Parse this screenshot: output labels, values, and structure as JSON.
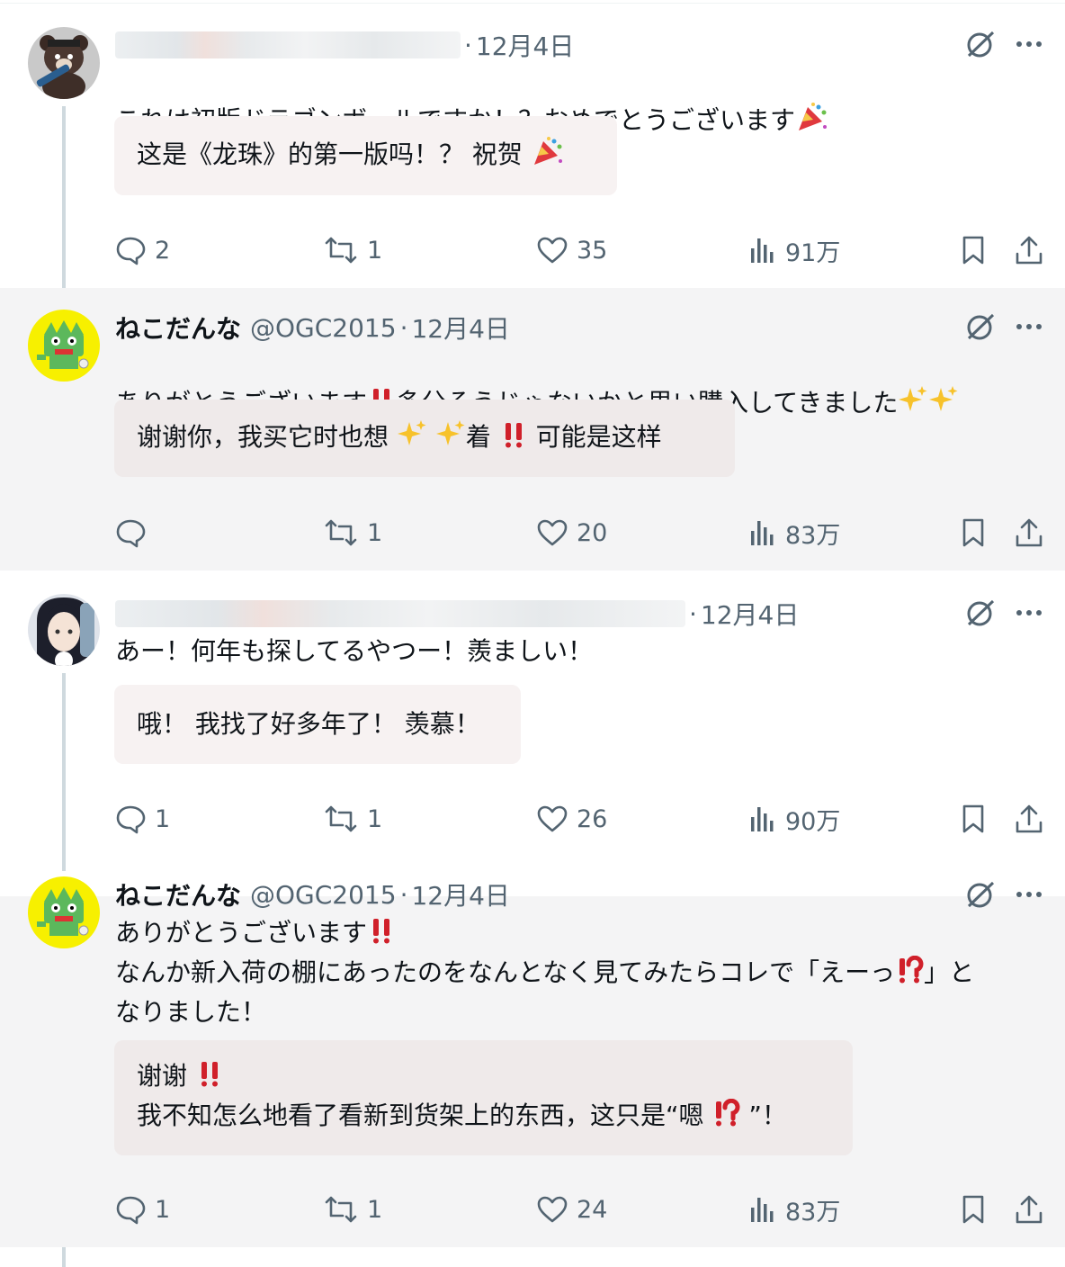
{
  "tweets": [
    {
      "author_name": "",
      "author_handle": "",
      "dot": "·",
      "date": "12月4日",
      "text": "これは初版ドラゴンボールですか！？おめでとうございます",
      "translation": "这是《龙珠》的第一版吗！？ 祝贺",
      "stats": {
        "replies": "2",
        "retweets": "1",
        "likes": "35",
        "views": "91万"
      }
    },
    {
      "author_name": "ねこだんな",
      "author_handle": "@OGC2015",
      "dot": "·",
      "date": "12月4日",
      "text_a": "ありがとうございます",
      "text_b": "多分そうじゃないかと思い購入してきました",
      "translation_a": "谢谢你，我买它时也想",
      "translation_b": "着",
      "translation_c": "可能是这样",
      "stats": {
        "replies": "",
        "retweets": "1",
        "likes": "20",
        "views": "83万"
      }
    },
    {
      "author_name": "",
      "author_handle": "",
      "dot": "·",
      "date": "12月4日",
      "text": "あー！何年も探してるやつー！羨ましい！",
      "translation": "哦！ 我找了好多年了！ 羡慕！",
      "stats": {
        "replies": "1",
        "retweets": "1",
        "likes": "26",
        "views": "90万"
      }
    },
    {
      "author_name": "ねこだんな",
      "author_handle": "@OGC2015",
      "dot": "·",
      "date": "12月4日",
      "text_line1": "ありがとうございます",
      "text_line2a": "なんか新入荷の棚にあったのをなんとなく見てみたらコレで「えーっ",
      "text_line2b": "」と",
      "text_line3": "なりました！",
      "translation_line1": "谢谢",
      "translation_line2a": "我不知怎么地看了看新到货架上的东西，这只是“嗯",
      "translation_line2b": "”！",
      "stats": {
        "replies": "1",
        "retweets": "1",
        "likes": "24",
        "views": "83万"
      }
    }
  ],
  "icons": {
    "grok": "grok-icon",
    "more": "more-icon",
    "reply": "reply-icon",
    "retweet": "retweet-icon",
    "like": "heart-icon",
    "views": "views-icon",
    "bookmark": "bookmark-icon",
    "share": "share-icon"
  },
  "colors": {
    "thread_line": "#cfd9de",
    "secondary_text": "#536471",
    "highlight_bg": "#f4f4f5",
    "translation_bg": "#f7f2f2",
    "emoji_red": "#d0202a"
  }
}
